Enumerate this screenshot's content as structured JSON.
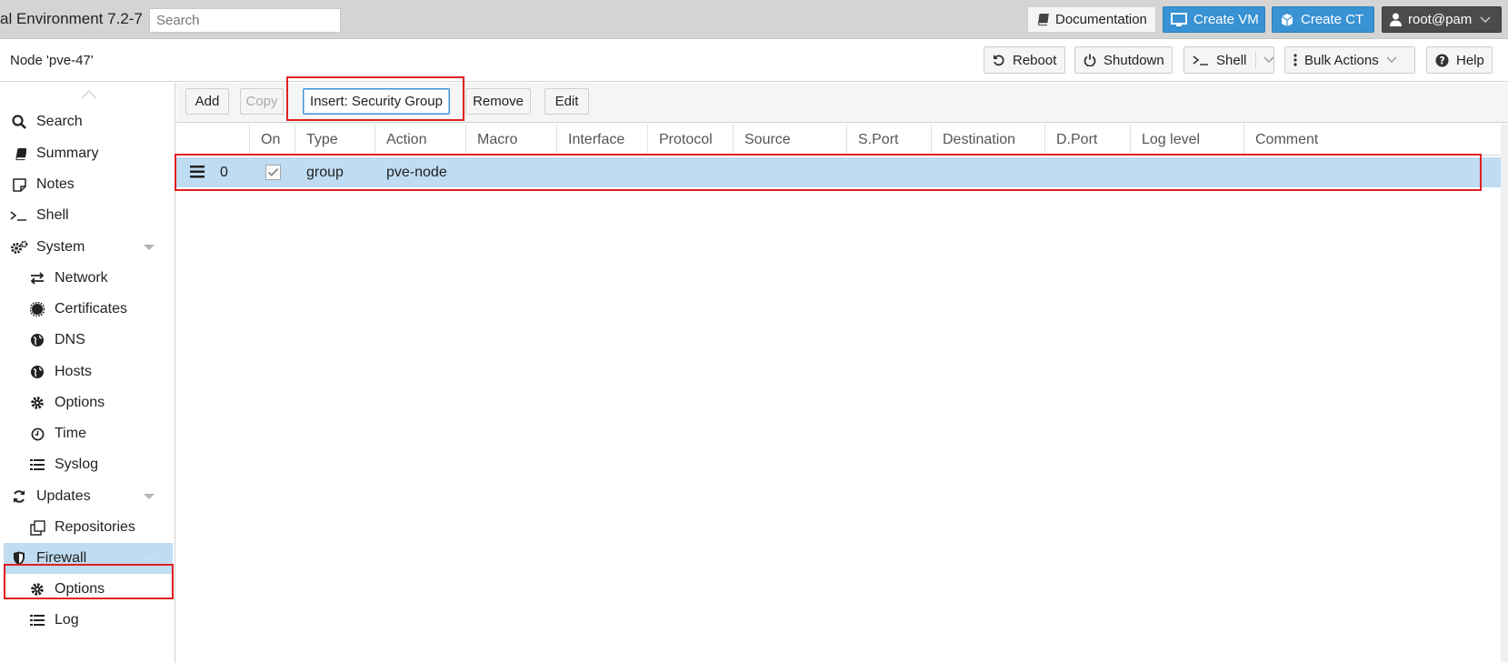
{
  "app": {
    "title": "al Environment 7.2-7",
    "search_placeholder": "Search"
  },
  "topbar": {
    "documentation": "Documentation",
    "create_vm": "Create VM",
    "create_ct": "Create CT",
    "user": "root@pam"
  },
  "node": {
    "title": "Node 'pve-47'",
    "reboot": "Reboot",
    "shutdown": "Shutdown",
    "shell": "Shell",
    "bulk_actions": "Bulk Actions",
    "help": "Help"
  },
  "sidebar": {
    "items": [
      {
        "label": "Search",
        "icon": "search-icon"
      },
      {
        "label": "Summary",
        "icon": "book-icon"
      },
      {
        "label": "Notes",
        "icon": "note-icon"
      },
      {
        "label": "Shell",
        "icon": "terminal-icon"
      },
      {
        "label": "System",
        "icon": "gears-icon"
      },
      {
        "label": "Network",
        "icon": "exchange-icon"
      },
      {
        "label": "Certificates",
        "icon": "certificate-icon"
      },
      {
        "label": "DNS",
        "icon": "globe-icon"
      },
      {
        "label": "Hosts",
        "icon": "globe-icon"
      },
      {
        "label": "Options",
        "icon": "gear-icon"
      },
      {
        "label": "Time",
        "icon": "clock-icon"
      },
      {
        "label": "Syslog",
        "icon": "list-icon"
      },
      {
        "label": "Updates",
        "icon": "refresh-icon"
      },
      {
        "label": "Repositories",
        "icon": "copy-icon"
      },
      {
        "label": "Firewall",
        "icon": "shield-icon"
      },
      {
        "label": "Options",
        "icon": "gear-icon"
      },
      {
        "label": "Log",
        "icon": "list-icon"
      }
    ]
  },
  "toolbar": {
    "add": "Add",
    "copy": "Copy",
    "insert_security_group": "Insert: Security Group",
    "remove": "Remove",
    "edit": "Edit"
  },
  "grid": {
    "columns": [
      "On",
      "Type",
      "Action",
      "Macro",
      "Interface",
      "Protocol",
      "Source",
      "S.Port",
      "Destination",
      "D.Port",
      "Log level",
      "Comment"
    ],
    "rows": [
      {
        "pos": "0",
        "on": true,
        "type": "group",
        "action": "pve-node",
        "macro": "",
        "interface": "",
        "protocol": "",
        "source": "",
        "sport": "",
        "destination": "",
        "dport": "",
        "log": "",
        "comment": ""
      }
    ]
  },
  "colors": {
    "accent": "#3892d4",
    "selection": "#bfdcf2",
    "highlight_box": "#e02020",
    "topbar_bg": "#d4d4d4"
  }
}
